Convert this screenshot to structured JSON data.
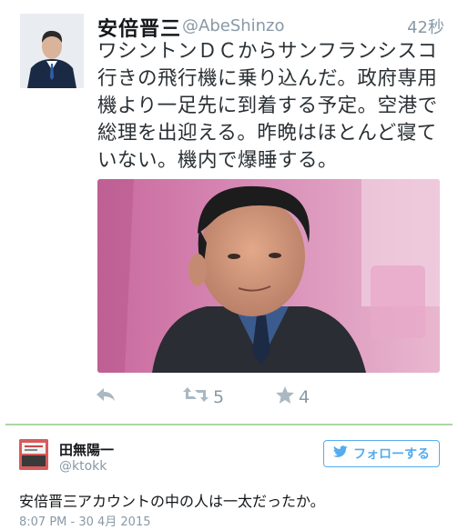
{
  "tweet": {
    "author_name": "安倍晋三",
    "author_handle": "@AbeShinzo",
    "time": "42秒",
    "text": "ワシントンＤＣからサンフランシスコ行きの飛行機に乗り込んだ。政府専用機より一足先に到着する予定。空港で総理を出迎える。昨晩はほとんど寝ていない。機内で爆睡する。",
    "retweet_count": "5",
    "favorite_count": "4"
  },
  "reply": {
    "author_name": "田無陽一",
    "author_handle": "@ktokk",
    "follow_label": "フォローする",
    "text": "安倍晋三アカウントの中の人は一太だったか。",
    "date": "8:07 PM - 30 4月 2015"
  },
  "colors": {
    "accent": "#55acee",
    "muted": "#8899a6",
    "icon": "#aab8c2",
    "divider": "#aed7a4"
  },
  "icons": {
    "reply": "reply-icon",
    "retweet": "retweet-icon",
    "favorite": "star-icon",
    "follow": "twitter-bird-icon"
  }
}
